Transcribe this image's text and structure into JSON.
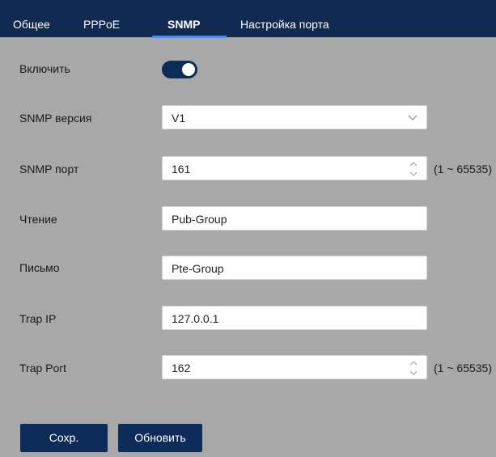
{
  "tabs": [
    {
      "label": "Общее"
    },
    {
      "label": "PPPoE"
    },
    {
      "label": "SNMP",
      "active": true
    },
    {
      "label": "Настройка порта"
    }
  ],
  "form": {
    "enable": {
      "label": "Включить",
      "checked": true
    },
    "version": {
      "label": "SNMP версия",
      "value": "V1"
    },
    "port": {
      "label": "SNMP порт",
      "value": "161",
      "range": "(1 ~ 65535)"
    },
    "read": {
      "label": "Чтение",
      "value": "Pub-Group"
    },
    "write": {
      "label": "Письмо",
      "value": "Pte-Group"
    },
    "trap_ip": {
      "label": "Trap IP",
      "value": "127.0.0.1"
    },
    "trap_port": {
      "label": "Trap Port",
      "value": "162",
      "range": "(1 ~ 65535)"
    }
  },
  "buttons": {
    "save": "Сохр.",
    "refresh": "Обновить"
  },
  "colors": {
    "header_bg": "#112a52",
    "active_tab_underline": "#4a8cff",
    "panel_bg": "#a8a8a8",
    "button_bg": "#0e2c5a"
  },
  "icons": {
    "select_arrow": "chevron-down-icon",
    "spinner": "spinner-arrows-icon"
  }
}
